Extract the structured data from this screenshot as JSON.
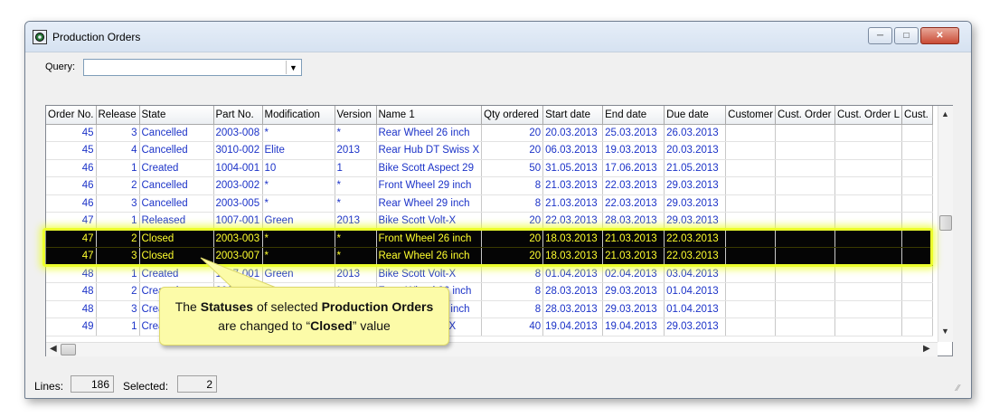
{
  "window": {
    "title": "Production Orders"
  },
  "query": {
    "label": "Query:",
    "value": ""
  },
  "columns": [
    "Order No.",
    "Release",
    "State",
    "Part No.",
    "Modification",
    "Version",
    "Name 1",
    "Qty ordered",
    "Start date",
    "End date",
    "Due date",
    "Customer",
    "Cust. Order",
    "Cust. Order L",
    "Cust."
  ],
  "rows": [
    {
      "order": "45",
      "release": "3",
      "state": "Cancelled",
      "part": "2003-008",
      "mod": "*",
      "ver": "*",
      "name": "Rear Wheel 26 inch",
      "qty": "20",
      "start": "20.03.2013",
      "end": "25.03.2013",
      "due": "26.03.2013",
      "selected": false
    },
    {
      "order": "45",
      "release": "4",
      "state": "Cancelled",
      "part": "3010-002",
      "mod": "Elite",
      "ver": "2013",
      "name": "Rear Hub DT Swiss X",
      "qty": "20",
      "start": "06.03.2013",
      "end": "19.03.2013",
      "due": "20.03.2013",
      "selected": false
    },
    {
      "order": "46",
      "release": "1",
      "state": "Created",
      "part": "1004-001",
      "mod": "10",
      "ver": "1",
      "name": "Bike Scott Aspect 29",
      "qty": "50",
      "start": "31.05.2013",
      "end": "17.06.2013",
      "due": "21.05.2013",
      "selected": false
    },
    {
      "order": "46",
      "release": "2",
      "state": "Cancelled",
      "part": "2003-002",
      "mod": "*",
      "ver": "*",
      "name": "Front Wheel 29 inch",
      "qty": "8",
      "start": "21.03.2013",
      "end": "22.03.2013",
      "due": "29.03.2013",
      "selected": false
    },
    {
      "order": "46",
      "release": "3",
      "state": "Cancelled",
      "part": "2003-005",
      "mod": "*",
      "ver": "*",
      "name": "Rear Wheel 29 inch",
      "qty": "8",
      "start": "21.03.2013",
      "end": "22.03.2013",
      "due": "29.03.2013",
      "selected": false
    },
    {
      "order": "47",
      "release": "1",
      "state": "Released",
      "part": "1007-001",
      "mod": "Green",
      "ver": "2013",
      "name": "Bike Scott Volt-X",
      "qty": "20",
      "start": "22.03.2013",
      "end": "28.03.2013",
      "due": "29.03.2013",
      "selected": false
    },
    {
      "order": "47",
      "release": "2",
      "state": "Closed",
      "part": "2003-003",
      "mod": "*",
      "ver": "*",
      "name": "Front Wheel 26 inch",
      "qty": "20",
      "start": "18.03.2013",
      "end": "21.03.2013",
      "due": "22.03.2013",
      "selected": true
    },
    {
      "order": "47",
      "release": "3",
      "state": "Closed",
      "part": "2003-007",
      "mod": "*",
      "ver": "*",
      "name": "Rear Wheel 26 inch",
      "qty": "20",
      "start": "18.03.2013",
      "end": "21.03.2013",
      "due": "22.03.2013",
      "selected": true
    },
    {
      "order": "48",
      "release": "1",
      "state": "Created",
      "part": "1007-001",
      "mod": "Green",
      "ver": "2013",
      "name": "Bike Scott Volt-X",
      "qty": "8",
      "start": "01.04.2013",
      "end": "02.04.2013",
      "due": "03.04.2013",
      "selected": false
    },
    {
      "order": "48",
      "release": "2",
      "state": "Created",
      "part": "2003-003",
      "mod": "*",
      "ver": "*",
      "name": "Front Wheel 26 inch",
      "qty": "8",
      "start": "28.03.2013",
      "end": "29.03.2013",
      "due": "01.04.2013",
      "selected": false
    },
    {
      "order": "48",
      "release": "3",
      "state": "Created",
      "part": "2003-007",
      "mod": "*",
      "ver": "*",
      "name": "Rear Wheel 26 inch",
      "qty": "8",
      "start": "28.03.2013",
      "end": "29.03.2013",
      "due": "01.04.2013",
      "selected": false
    },
    {
      "order": "49",
      "release": "1",
      "state": "Created",
      "part": "1007-001",
      "mod": "Green",
      "ver": "2013",
      "name": "Bike Scott Volt-X",
      "qty": "40",
      "start": "19.04.2013",
      "end": "19.04.2013",
      "due": "29.03.2013",
      "selected": false
    }
  ],
  "callout": {
    "part1": "The ",
    "bold1": "Statuses",
    "part2": " of selected ",
    "bold2": "Production Orders",
    "part3": " are changed to “",
    "bold3": "Closed",
    "part4": "” value"
  },
  "status": {
    "lines_label": "Lines:",
    "lines_value": "186",
    "selected_label": "Selected:",
    "selected_value": "2"
  },
  "colors": {
    "highlight": "#ecff2c",
    "selected_bg": "#050505",
    "selected_text": "#ffff2e",
    "cell_text": "#1c33c8",
    "callout_bg": "#fcfba8"
  },
  "icons": [
    "app-icon",
    "minimize-icon",
    "maximize-icon",
    "close-icon",
    "dropdown-arrow-icon",
    "scroll-up-icon",
    "scroll-down-icon",
    "scroll-left-icon",
    "scroll-right-icon",
    "resize-grip-icon"
  ]
}
